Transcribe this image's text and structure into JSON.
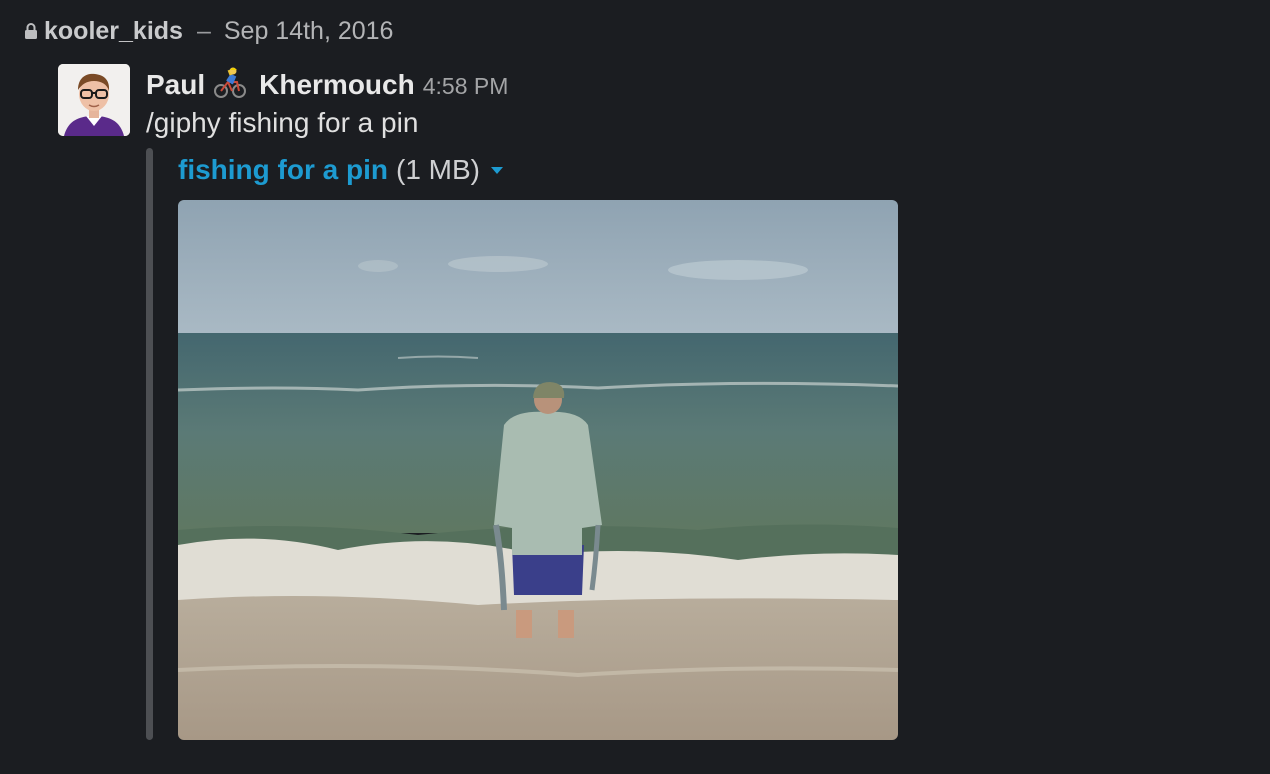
{
  "header": {
    "channel": "kooler_kids",
    "separator": "–",
    "date": "Sep 14th, 2016"
  },
  "message": {
    "first_name": "Paul",
    "last_name": "Khermouch",
    "time": "4:58 PM",
    "text": "/giphy fishing for a pin"
  },
  "attachment": {
    "title": "fishing for a pin",
    "size": "(1 MB)"
  },
  "colors": {
    "background": "#1b1d21",
    "link": "#1d9bd1",
    "attachment_bar": "#4d4f53"
  },
  "icons": [
    "lock-icon",
    "bicyclist-emoji-icon",
    "caret-down-icon"
  ]
}
